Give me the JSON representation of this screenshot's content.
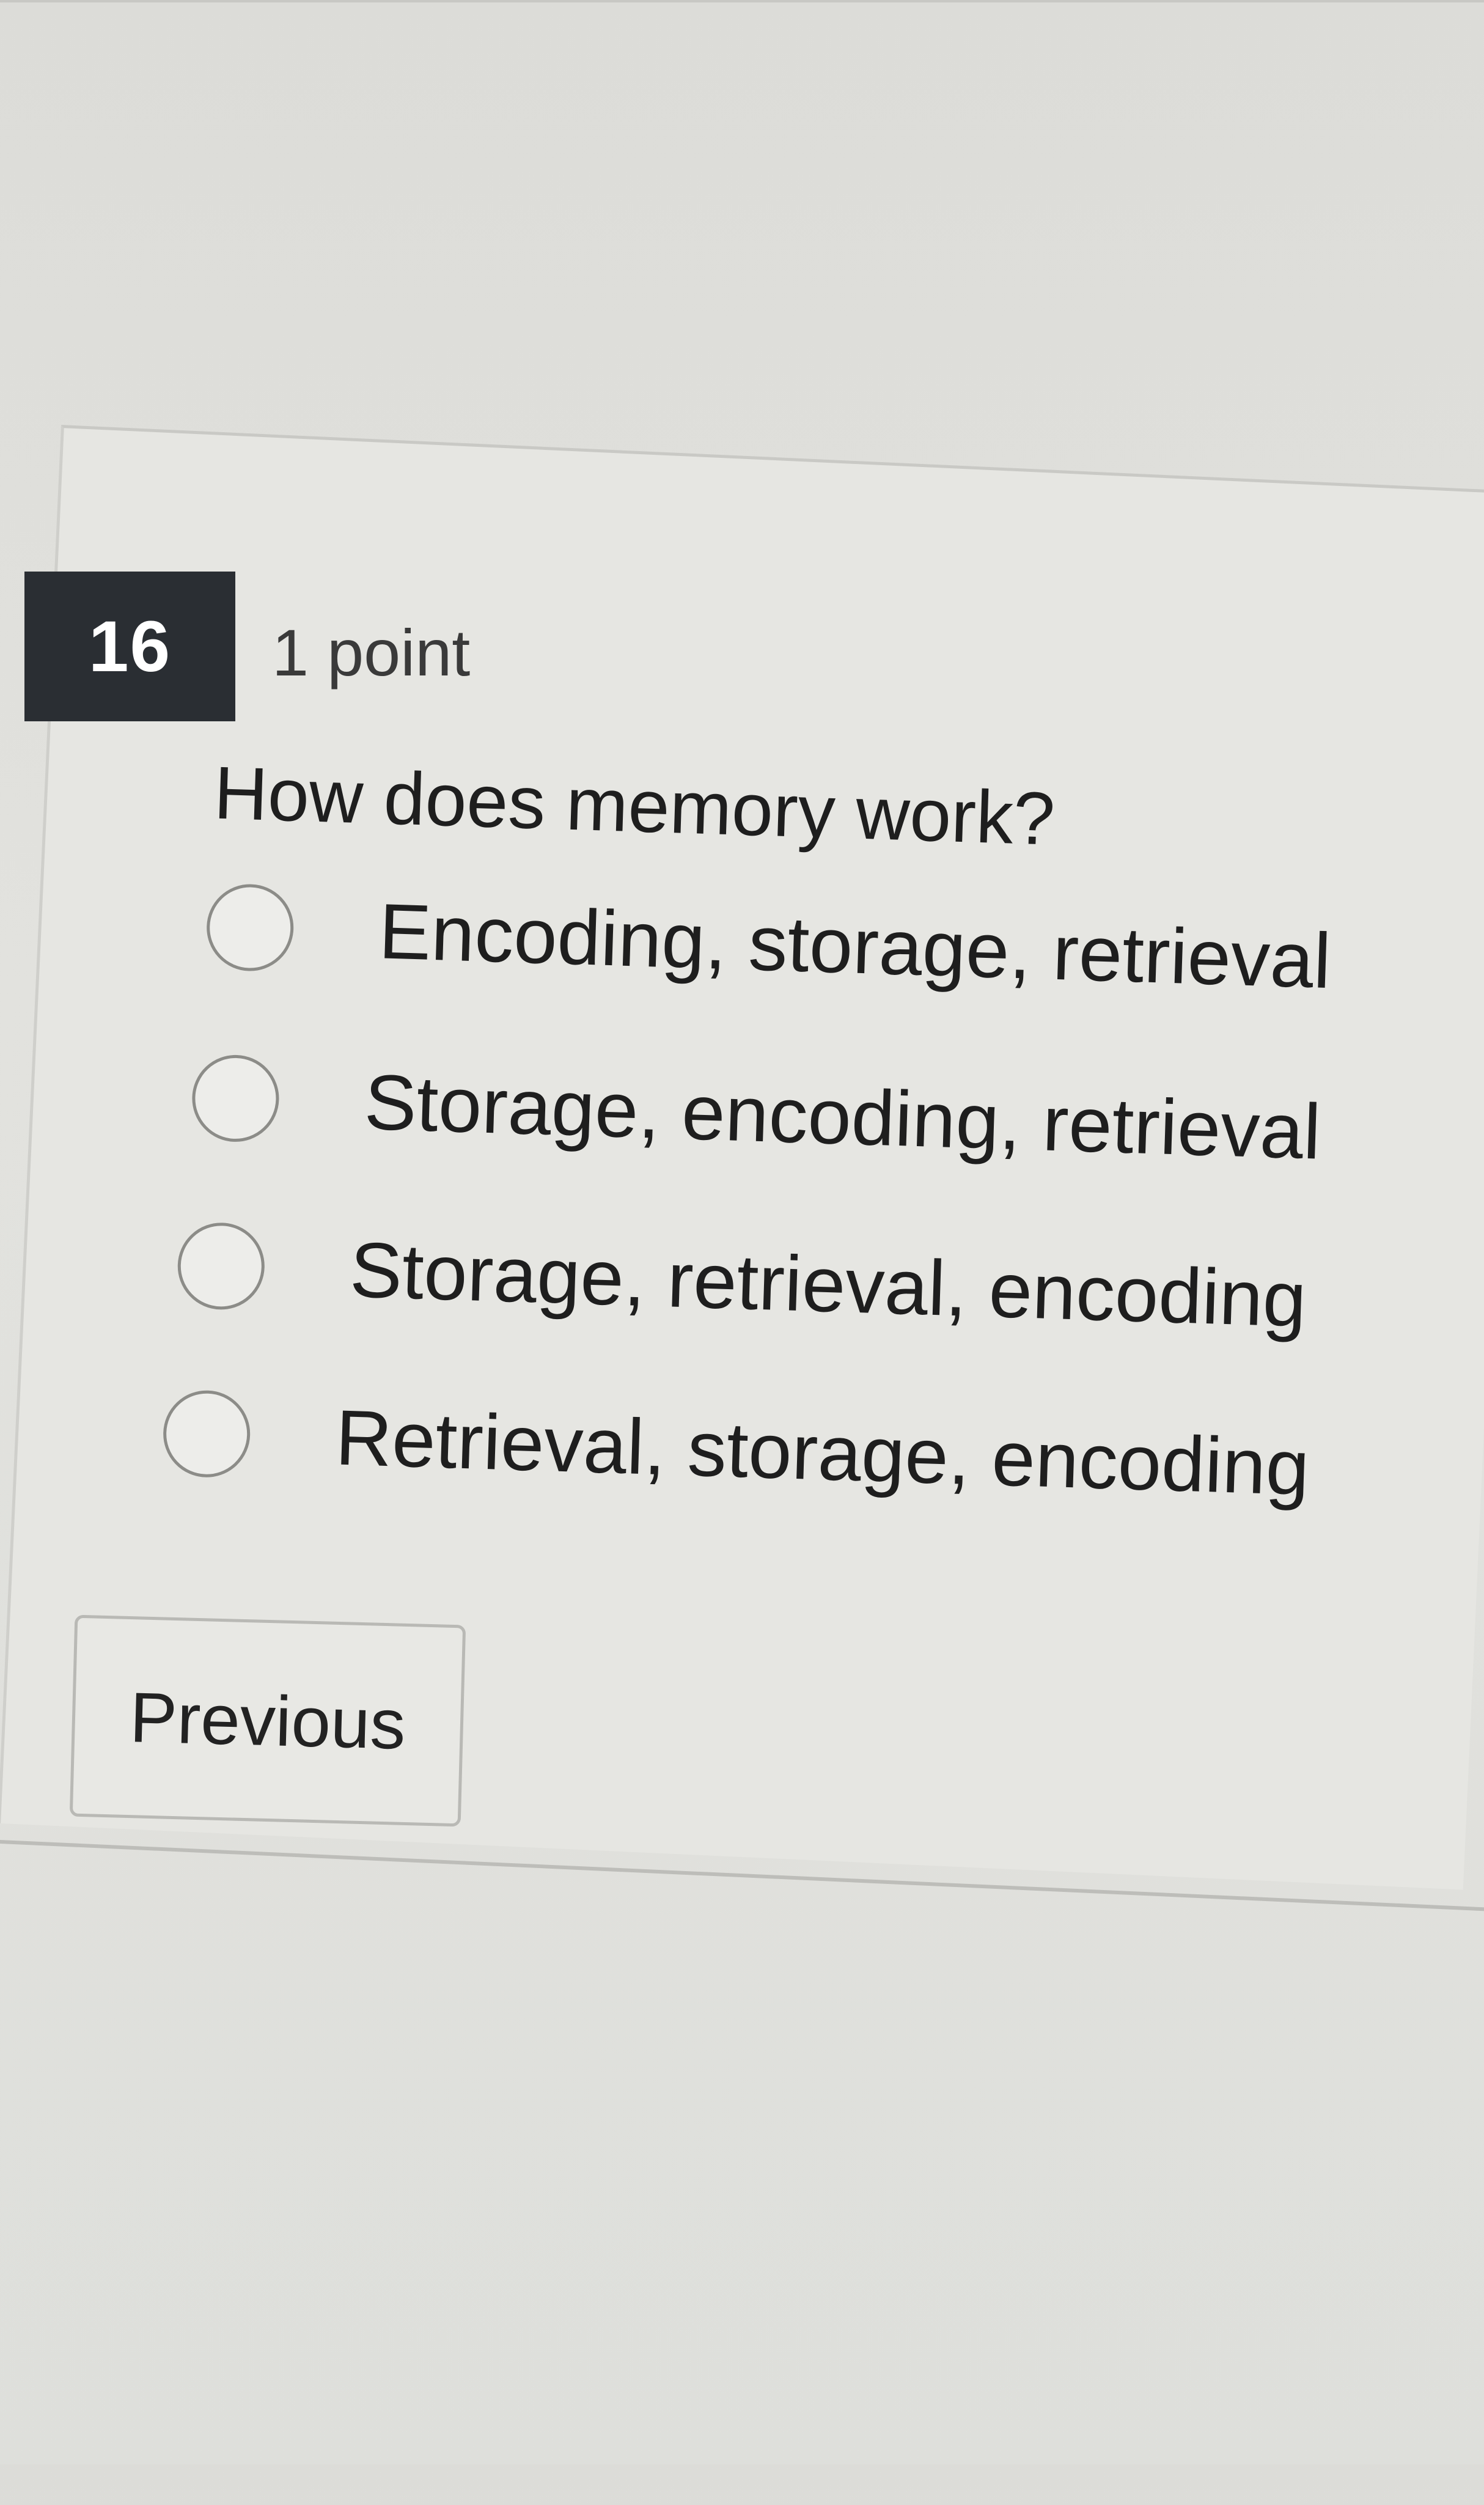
{
  "question": {
    "number": "16",
    "points": "1 point",
    "text": "How does memory work?",
    "options": [
      "Encoding, storage, retrieval",
      "Storage, encoding, retrieval",
      "Storage, retrieval, encoding",
      "Retrieval, storage, encoding"
    ]
  },
  "navigation": {
    "previous_label": "Previous"
  }
}
